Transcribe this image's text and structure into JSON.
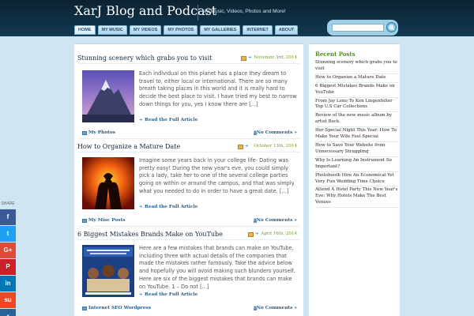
{
  "header": {
    "title": "XarJ Blog and Podcast",
    "tagline": "My Music, Videos, Photos and More!"
  },
  "nav": [
    "HOME",
    "MY MUSIC",
    "MY VIDEOS",
    "MY PHOTOS",
    "MY GALLERIES",
    "INTERNET",
    "ABOUT"
  ],
  "search": {
    "placeholder": ""
  },
  "posts": [
    {
      "title": "Stunning scenery which grabs you to visit",
      "date": "Novembr 3rd, 2014",
      "excerpt": "Each individual on this planet has a place they dream to travel to, either local or international. There are so many breath taking places in this world and it is really hard to decide the best place to visit. I have tried my best to narrow down things for you, yes I know there are [...]",
      "read_more": "Read the Full Article",
      "category": "My Photos",
      "comments": "No Comments »"
    },
    {
      "title": "How to Organize a Mature Date",
      "date": "October 13th, 2014",
      "excerpt": "Imagine some years back in your college life- Dating was pretty easy! During the new year's eve, you could simply pick a lady, take her to one of the several college parties going on within or around the campus, and that was simply what you needed to do in order to have a great date. [...]",
      "read_more": "Read the Full Article",
      "category": "My Misc Posts",
      "comments": "No Comments »"
    },
    {
      "title": "6 Biggest Mistakes Brands Make on YouTube",
      "date": "April 16th, 2014",
      "excerpt": "Here are a few mistakes that brands can make on YouTube, including three with actual details of the companies that made the mistakes rather famously. Take the advice below and hopefully you will avoid making such blunders yourself. Here are six of the biggest mistakes that brands can make on YouTube. 1 – Do not [...]",
      "read_more": "Read the Full Article",
      "category": "Internet SEO Wordpress",
      "comments": "No Comments »"
    }
  ],
  "sidebar": {
    "title": "Recent Posts",
    "items": [
      "Stunning scenery which grabs you to visit",
      "How to Organize a Mature Date",
      "6 Biggest Mistakes Brands Make on YouTube",
      "From Jay Leno To Ken Lingenfelter Top U.S Car Collections",
      "Review of the new music album by artist Beck",
      "Her Special Night This Year: How To Make Your Wife Feel Special",
      "How to Save Your Website from Unnecessary Struggling",
      "Why Is Learning An Instrument So Important?",
      "Photobooth Hire An Economical Yet Very Fun Wedding Time Choice",
      "Attend A Hotel Party This New Year's Eve: Why Hotels Make The Best Venues"
    ]
  },
  "share": {
    "label": "SHARE",
    "buttons": [
      {
        "name": "facebook",
        "glyph": "f",
        "color": "#3b5998"
      },
      {
        "name": "twitter",
        "glyph": "t",
        "color": "#1da1f2"
      },
      {
        "name": "google-plus",
        "glyph": "G+",
        "color": "#dd4b39"
      },
      {
        "name": "pinterest",
        "glyph": "P",
        "color": "#cb2027"
      },
      {
        "name": "linkedin",
        "glyph": "in",
        "color": "#0077b5"
      },
      {
        "name": "stumbleupon",
        "glyph": "su",
        "color": "#eb4924"
      },
      {
        "name": "reddit",
        "glyph": "r",
        "color": "#2a6496"
      }
    ]
  }
}
